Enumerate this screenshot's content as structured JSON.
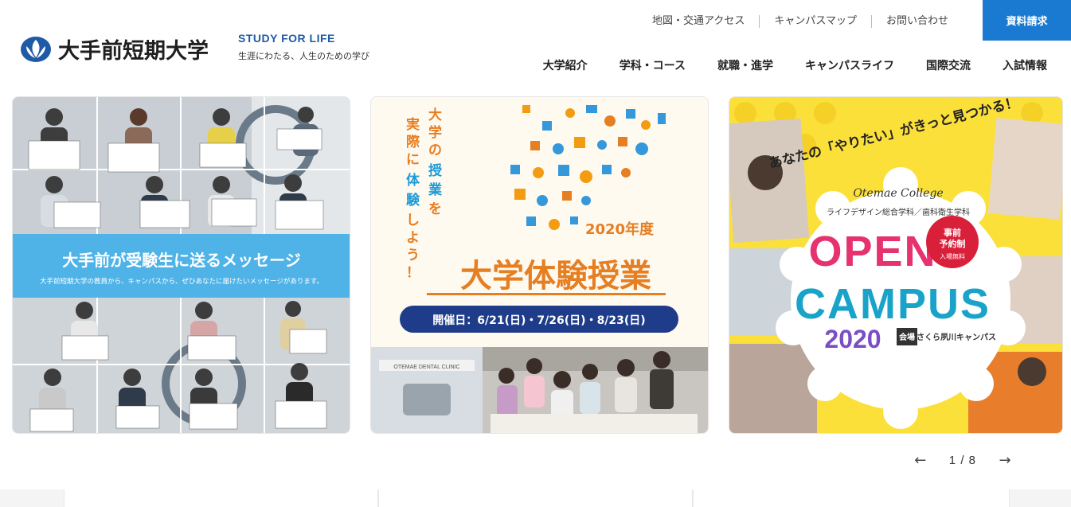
{
  "header": {
    "logo_text": "大手前短期大学",
    "tagline_en": "STUDY FOR LIFE",
    "tagline_ja": "生涯にわたる、人生のための学び",
    "doc_request": "資料請求",
    "utility_links": [
      {
        "label": "地図・交通アクセス"
      },
      {
        "label": "キャンパスマップ"
      },
      {
        "label": "お問い合わせ"
      }
    ],
    "main_nav": [
      {
        "label": "大学紹介"
      },
      {
        "label": "学科・コース"
      },
      {
        "label": "就職・進学"
      },
      {
        "label": "キャンパスライフ"
      },
      {
        "label": "国際交流"
      },
      {
        "label": "入試情報"
      }
    ]
  },
  "slides": {
    "slide1": {
      "title": "大手前が受験生に送るメッセージ",
      "subtitle": "大手前短期大学の教員から、キャンパスから、ぜひあなたに届けたいメッセージがあります。"
    },
    "slide2": {
      "vertical_text": "大学の授業を実際に体験しよう！",
      "year": "2020年度",
      "title": "大学体験授業",
      "dates": "開催日：6/21(日)・7/26(日)・8/23(日)",
      "clinic_sign": "OTEMAE DENTAL CLINIC"
    },
    "slide3": {
      "headline": "あなたの「やりたい」がきっと見つかる！",
      "college": "Otemae College",
      "departments": "ライフデザイン総合学科／歯科衛生学科",
      "open": "OPEN",
      "campus": "CAMPUS",
      "year": "2020",
      "badge_line1": "事前",
      "badge_line2": "予約制",
      "badge_line3": "入場無料",
      "venue_label": "会場",
      "venue": "さくら夙川キャンパス"
    }
  },
  "pager": {
    "prev": "←",
    "next": "→",
    "current": "1",
    "total": "8",
    "separator": "/"
  },
  "colors": {
    "accent": "#1a7ad1",
    "brand_blue": "#1f5aa6",
    "banner_blue": "#4fb3e8",
    "date_navy": "#1f3c8a",
    "yellow": "#fbe03a"
  }
}
